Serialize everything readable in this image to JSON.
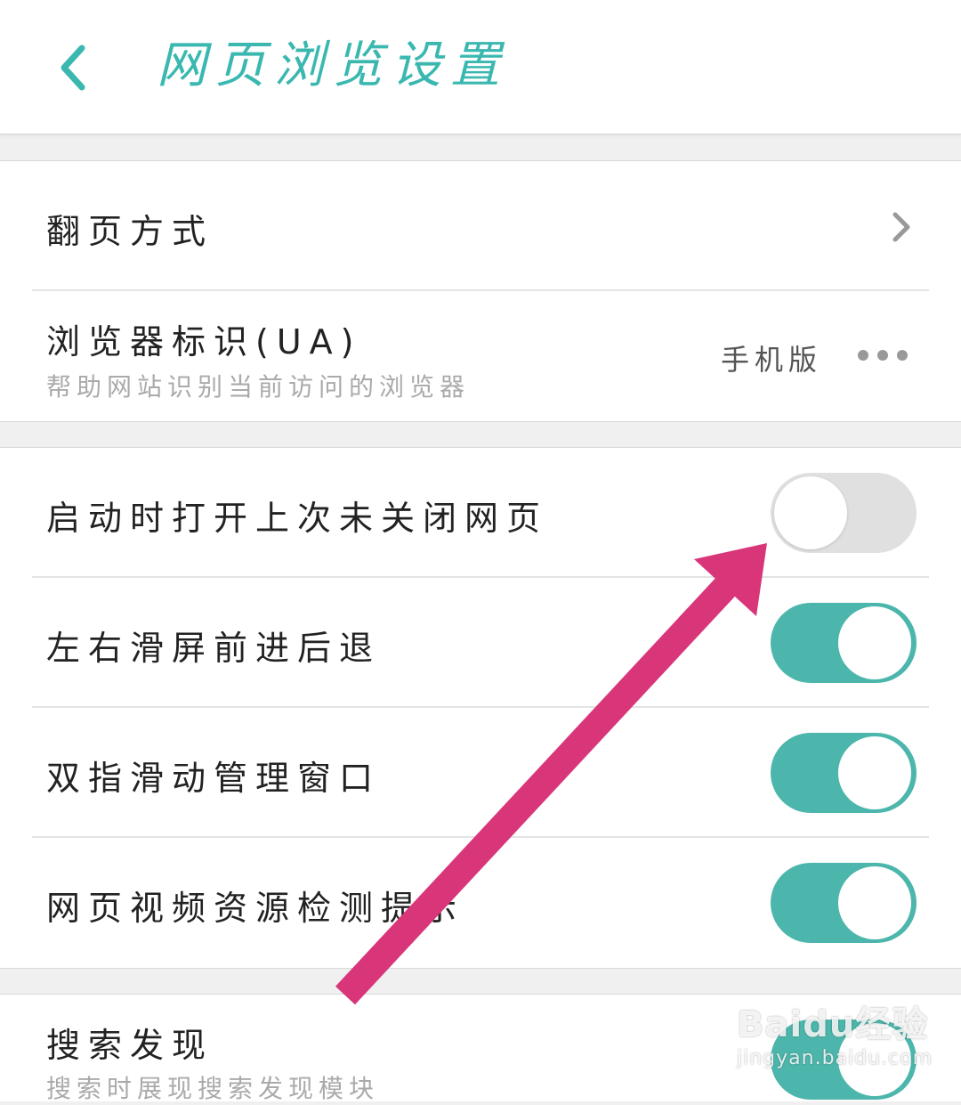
{
  "colors": {
    "accent": "#3ab8b0",
    "toggle_on": "#4db6ac",
    "toggle_off": "#e0e0e0",
    "arrow": "#d9367a"
  },
  "header": {
    "title": "网页浏览设置",
    "back_icon": "chevron-left-icon"
  },
  "page_mode": {
    "label": "翻页方式",
    "icon": "chevron-right-icon"
  },
  "user_agent": {
    "label": "浏览器标识(UA)",
    "sublabel": "帮助网站识别当前访问的浏览器",
    "value": "手机版",
    "icon": "more-dots-icon"
  },
  "toggles": [
    {
      "label": "启动时打开上次未关闭网页",
      "on": false
    },
    {
      "label": "左右滑屏前进后退",
      "on": true
    },
    {
      "label": "双指滑动管理窗口",
      "on": true
    },
    {
      "label": "网页视频资源检测提示",
      "on": true
    }
  ],
  "search_discovery": {
    "label": "搜索发现",
    "sublabel": "搜索时展现搜索发现模块",
    "on": true
  },
  "watermark": {
    "logo": "Baidu经验",
    "url": "jingyan.baidu.com"
  }
}
